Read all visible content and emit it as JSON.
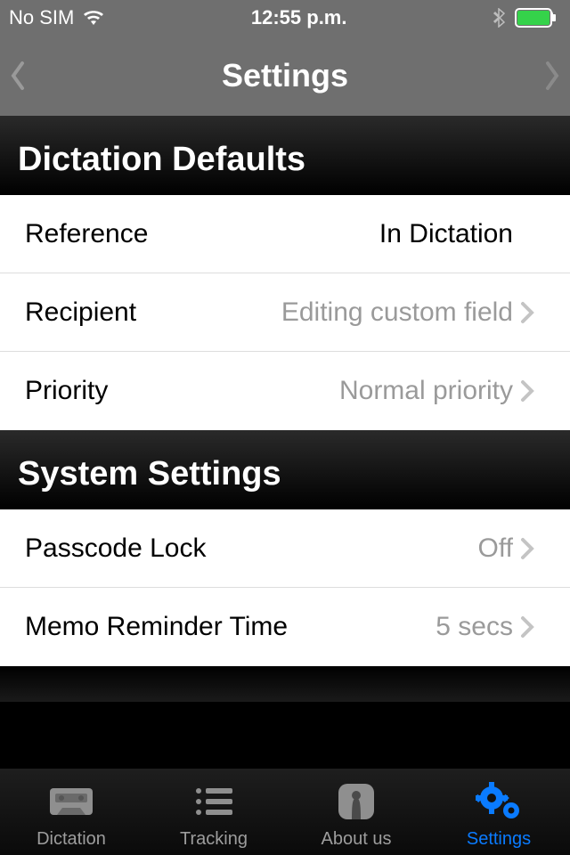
{
  "status": {
    "carrier": "No SIM",
    "time": "12:55 p.m."
  },
  "nav": {
    "title": "Settings"
  },
  "sections": {
    "dictation": {
      "header": "Dictation Defaults",
      "reference": {
        "label": "Reference",
        "value": "In Dictation"
      },
      "recipient": {
        "label": "Recipient",
        "value": "Editing custom field"
      },
      "priority": {
        "label": "Priority",
        "value": "Normal priority"
      }
    },
    "system": {
      "header": "System Settings",
      "passcode": {
        "label": "Passcode Lock",
        "value": "Off"
      },
      "memo": {
        "label": "Memo Reminder Time",
        "value": "5 secs"
      }
    }
  },
  "tabs": {
    "dictation": "Dictation",
    "tracking": "Tracking",
    "about": "About us",
    "settings": "Settings"
  }
}
